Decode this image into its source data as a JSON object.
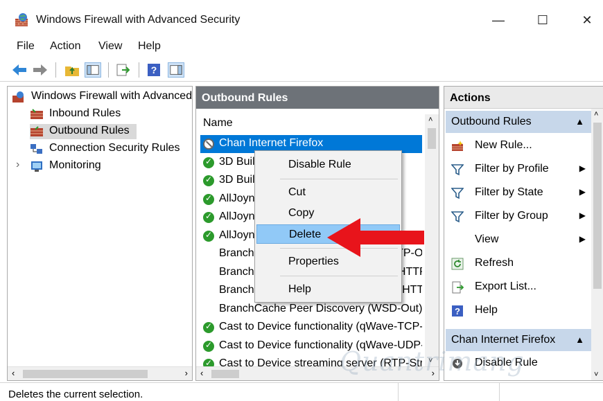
{
  "window": {
    "title": "Windows Firewall with Advanced Security",
    "minimize": "—",
    "maximize": "☐",
    "close": "✕"
  },
  "menu": [
    "File",
    "Action",
    "View",
    "Help"
  ],
  "tree": {
    "root": "Windows Firewall with Advanced Security",
    "items": [
      "Inbound Rules",
      "Outbound Rules",
      "Connection Security Rules",
      "Monitoring"
    ],
    "selected": "Outbound Rules",
    "expander": "›"
  },
  "center": {
    "header": "Outbound Rules",
    "column_name": "Name",
    "rows": [
      {
        "name": "Chan Internet Firefox",
        "status": "blocked",
        "selected": true
      },
      {
        "name": "3D Builder",
        "status": "enabled"
      },
      {
        "name": "3D Builder",
        "status": "enabled"
      },
      {
        "name": "AllJoyn Router (TCP-Out)",
        "status": "enabled"
      },
      {
        "name": "AllJoyn Router (UDP-Out)",
        "status": "enabled"
      },
      {
        "name": "AllJoyn Router (TCP-Out)",
        "status": "enabled"
      },
      {
        "name": "BranchCache Content Retrieval (HTTP-Out)",
        "status": "none"
      },
      {
        "name": "BranchCache Hosted Cache Client (HTTP-Out)",
        "status": "none"
      },
      {
        "name": "BranchCache Hosted Cache Server (HTTP-Out)",
        "status": "none"
      },
      {
        "name": "BranchCache Peer Discovery (WSD-Out)",
        "status": "none"
      },
      {
        "name": "Cast to Device functionality (qWave-TCP-Out)",
        "status": "enabled"
      },
      {
        "name": "Cast to Device functionality (qWave-UDP-Out)",
        "status": "enabled"
      },
      {
        "name": "Cast to Device streaming server (RTP-Streaming-Out)",
        "status": "enabled"
      }
    ]
  },
  "context_menu": {
    "items": [
      "Disable Rule",
      "Cut",
      "Copy",
      "Delete",
      "Properties",
      "Help"
    ],
    "highlighted": "Delete"
  },
  "actions": {
    "header": "Actions",
    "section1": "Outbound Rules",
    "section1_items": [
      {
        "label": "New Rule...",
        "icon": "new-rule-icon",
        "submenu": false
      },
      {
        "label": "Filter by Profile",
        "icon": "filter-icon",
        "submenu": true
      },
      {
        "label": "Filter by State",
        "icon": "filter-icon",
        "submenu": true
      },
      {
        "label": "Filter by Group",
        "icon": "filter-icon",
        "submenu": true
      },
      {
        "label": "View",
        "icon": "",
        "submenu": true
      },
      {
        "label": "Refresh",
        "icon": "refresh-icon",
        "submenu": false
      },
      {
        "label": "Export List...",
        "icon": "export-icon",
        "submenu": false
      },
      {
        "label": "Help",
        "icon": "help-icon",
        "submenu": false
      }
    ],
    "section2": "Chan Internet Firefox",
    "section2_items": [
      {
        "label": "Disable Rule",
        "icon": "disable-icon",
        "submenu": false
      }
    ]
  },
  "status": "Deletes the current selection.",
  "watermark": "Quantrimang",
  "colors": {
    "accent": "#0078d7",
    "arrow": "#e8141b",
    "pane_header": "#6d7278",
    "section_header": "#c7d7ea",
    "menu_highlight": "#91c9f7"
  }
}
